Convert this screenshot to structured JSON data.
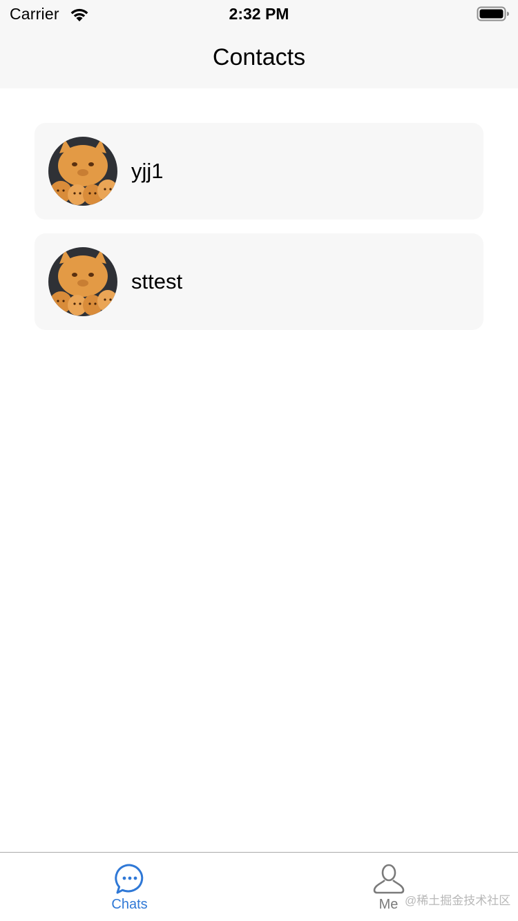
{
  "status_bar": {
    "carrier": "Carrier",
    "time": "2:32 PM"
  },
  "nav": {
    "title": "Contacts"
  },
  "contacts": [
    {
      "name": "yjj1",
      "avatar": "cat-photo"
    },
    {
      "name": "sttest",
      "avatar": "cat-photo"
    }
  ],
  "tab_bar": {
    "tabs": [
      {
        "label": "Chats",
        "icon": "chat-bubble-icon",
        "active": true
      },
      {
        "label": "Me",
        "icon": "person-icon",
        "active": false
      }
    ]
  },
  "watermark": "@稀土掘金技术社区",
  "colors": {
    "accent": "#2f78d6",
    "bar_background": "#f7f7f7",
    "card_background": "#f7f7f7",
    "inactive_tab": "#7a7a7a"
  }
}
